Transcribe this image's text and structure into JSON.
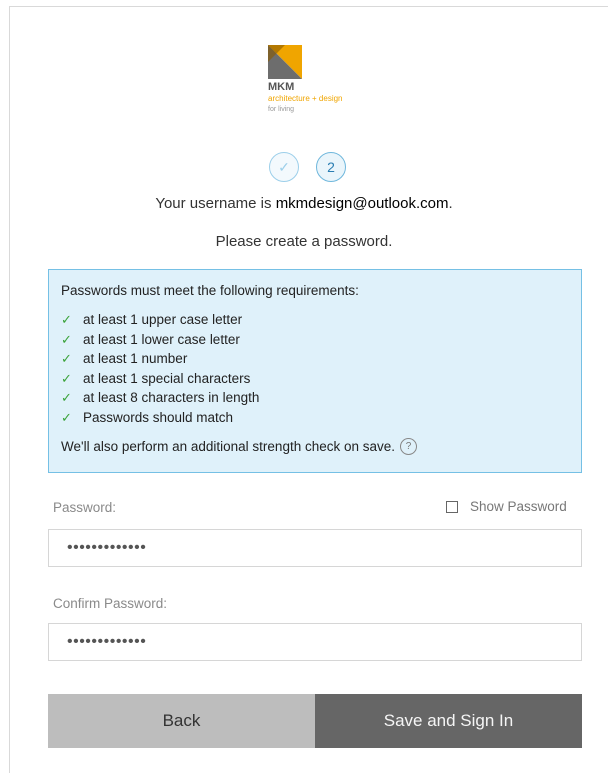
{
  "logo": {
    "brand": "MKM",
    "tagline": "architecture + design",
    "sub": "for living"
  },
  "steps": {
    "done_icon": "check-icon",
    "current": "2"
  },
  "intro": {
    "username_prefix": "Your username is ",
    "username": "mkmdesign@outlook.com",
    "username_suffix": ".",
    "create_prompt": "Please create a password."
  },
  "requirements": {
    "heading": "Passwords must meet the following requirements:",
    "items": [
      "at least 1 upper case letter",
      "at least 1 lower case letter",
      "at least 1 number",
      "at least 1 special characters",
      "at least 8 characters in length",
      "Passwords should match"
    ],
    "note": "We'll also perform an additional strength check on save.",
    "help_icon": "?"
  },
  "password": {
    "label": "Password:",
    "value": "•••••••••••••",
    "show_label": "Show Password"
  },
  "confirm": {
    "label": "Confirm Password:",
    "value": "•••••••••••••"
  },
  "buttons": {
    "back": "Back",
    "save": "Save and Sign In"
  },
  "colors": {
    "info_bg": "#dff1fa",
    "info_border": "#75c0e5",
    "check": "#3aa339",
    "save_bg": "#666666",
    "back_bg": "#bdbdbd",
    "logo_orange": "#f0a500"
  }
}
